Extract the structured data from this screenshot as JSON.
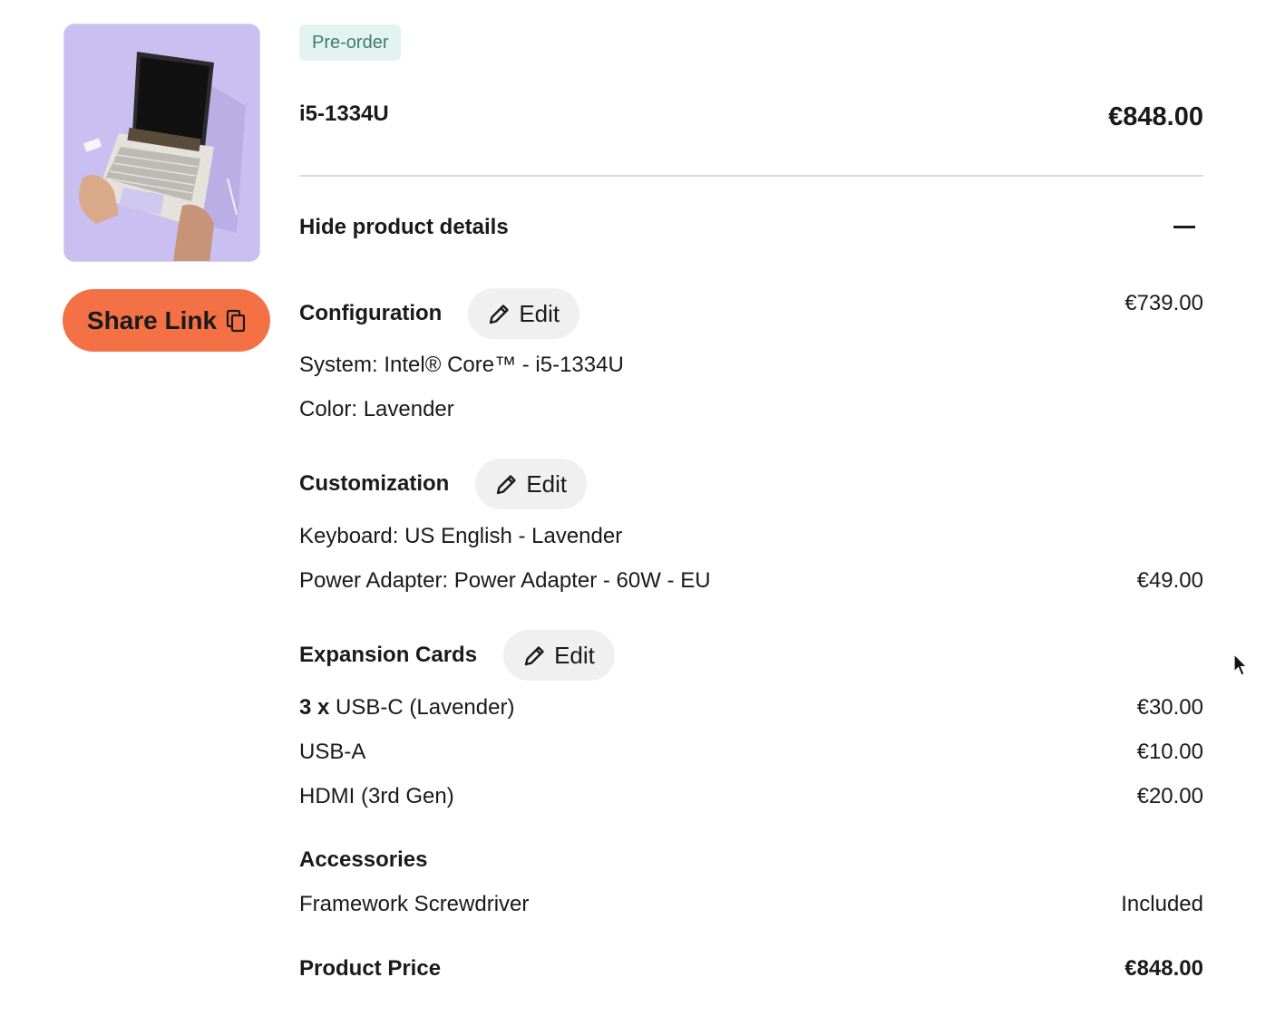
{
  "badge": "Pre-order",
  "product": {
    "name": "i5-1334U",
    "price": "€848.00"
  },
  "details_toggle": "Hide product details",
  "share_label": "Share Link",
  "edit_label": "Edit",
  "sections": {
    "configuration": {
      "title": "Configuration",
      "price": "€739.00",
      "lines": [
        {
          "label": "System: Intel® Core™ - i5-1334U"
        },
        {
          "label": "Color: Lavender"
        }
      ]
    },
    "customization": {
      "title": "Customization",
      "lines": [
        {
          "label": "Keyboard: US English - Lavender",
          "price": ""
        },
        {
          "label": "Power Adapter: Power Adapter - 60W - EU",
          "price": "€49.00"
        }
      ]
    },
    "expansion": {
      "title": "Expansion Cards",
      "lines": [
        {
          "qty": "3 x",
          "label": "USB-C (Lavender)",
          "price": "€30.00"
        },
        {
          "label": "USB-A",
          "price": "€10.00"
        },
        {
          "label": "HDMI (3rd Gen)",
          "price": "€20.00"
        }
      ]
    },
    "accessories": {
      "title": "Accessories",
      "lines": [
        {
          "label": "Framework Screwdriver",
          "price": "Included"
        }
      ]
    }
  },
  "summary": {
    "label": "Product Price",
    "price": "€848.00"
  },
  "colors": {
    "share_button": "#f47145",
    "badge_bg": "#e3f3ef",
    "badge_text": "#3e7d6c",
    "image_bg": "#c9bff0"
  }
}
